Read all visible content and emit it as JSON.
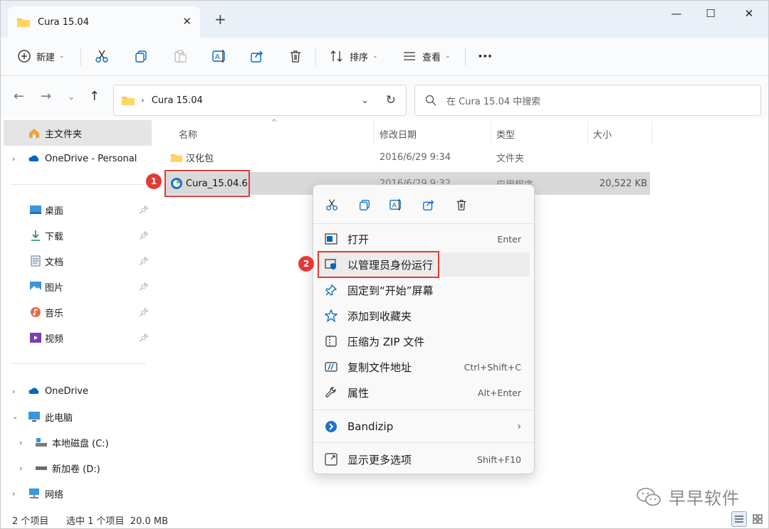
{
  "window": {
    "tab_title": "Cura 15.04",
    "tab_close": "✕",
    "new_tab": "+",
    "controls": {
      "minimize": "—",
      "maximize": "☐",
      "close": "✕"
    }
  },
  "toolbar": {
    "new_label": "新建",
    "sort_label": "排序",
    "view_label": "查看",
    "more_label": "···"
  },
  "address": {
    "path_segment": "Cura 15.04",
    "search_placeholder": "在 Cura 15.04 中搜索"
  },
  "sidebar": {
    "items": [
      {
        "label": "主文件夹"
      },
      {
        "label": "OneDrive - Personal"
      },
      {
        "label": "桌面"
      },
      {
        "label": "下载"
      },
      {
        "label": "文档"
      },
      {
        "label": "图片"
      },
      {
        "label": "音乐"
      },
      {
        "label": "视频"
      },
      {
        "label": "OneDrive"
      },
      {
        "label": "此电脑"
      },
      {
        "label": "本地磁盘 (C:)"
      },
      {
        "label": "新加卷 (D:)"
      },
      {
        "label": "网络"
      }
    ]
  },
  "columns": {
    "name": "名称",
    "modified": "修改日期",
    "type": "类型",
    "size": "大小"
  },
  "files": [
    {
      "name": "汉化包",
      "modified": "2016/6/29 9:34",
      "type": "文件夹",
      "size": ""
    },
    {
      "name": "Cura_15.04.6",
      "modified": "2016/6/29 9:32",
      "type": "应用程序",
      "size": "20,522 KB"
    }
  ],
  "annotations": {
    "step1": "1",
    "step2": "2"
  },
  "context_menu": {
    "items": [
      {
        "label": "打开",
        "shortcut": "Enter"
      },
      {
        "label": "以管理员身份运行",
        "shortcut": ""
      },
      {
        "label": "固定到“开始”屏幕",
        "shortcut": ""
      },
      {
        "label": "添加到收藏夹",
        "shortcut": ""
      },
      {
        "label": "压缩为 ZIP 文件",
        "shortcut": ""
      },
      {
        "label": "复制文件地址",
        "shortcut": "Ctrl+Shift+C"
      },
      {
        "label": "属性",
        "shortcut": "Alt+Enter"
      },
      {
        "label": "Bandizip",
        "shortcut": ""
      },
      {
        "label": "显示更多选项",
        "shortcut": "Shift+F10"
      }
    ]
  },
  "status": {
    "item_count": "2 个项目",
    "selection": "选中 1 个项目  20.0 MB"
  },
  "watermark": "早早软件",
  "colors": {
    "accent": "#0067c0",
    "folder": "#f4c14f",
    "annotation": "#e53935"
  }
}
